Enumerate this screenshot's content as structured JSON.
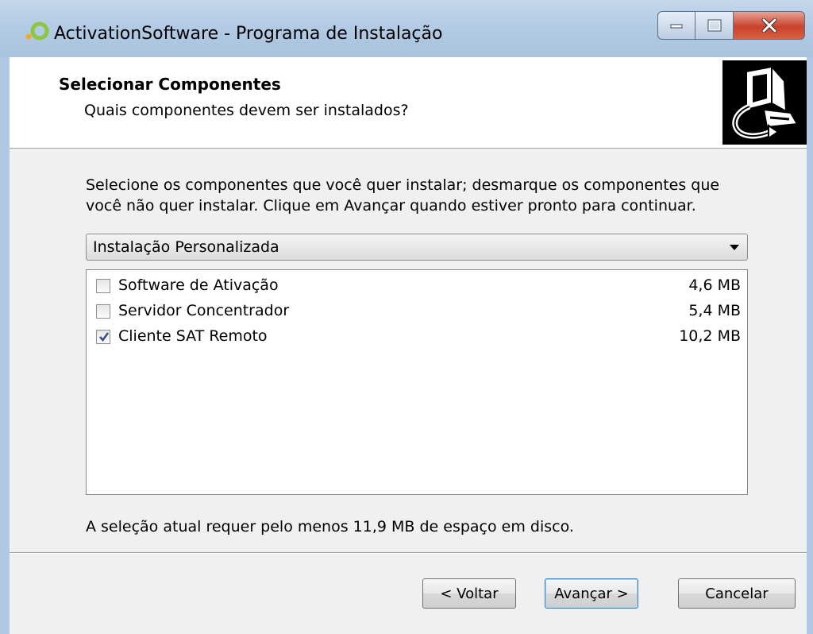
{
  "window": {
    "title": "ActivationSoftware - Programa de Instalação"
  },
  "header": {
    "title": "Selecionar Componentes",
    "subtitle": "Quais componentes devem ser instalados?"
  },
  "description": "Selecione os componentes que você quer instalar; desmarque os componentes que você não quer instalar. Clique em Avançar quando estiver pronto para continuar.",
  "install_type": {
    "selected": "Instalação Personalizada"
  },
  "components": [
    {
      "label": "Software de Ativação",
      "size": "4,6 MB",
      "checked": false
    },
    {
      "label": "Servidor Concentrador",
      "size": "5,4 MB",
      "checked": false
    },
    {
      "label": "Cliente SAT Remoto",
      "size": "10,2 MB",
      "checked": true
    }
  ],
  "requirement": "A seleção atual requer pelo menos 11,9 MB de espaço em disco.",
  "buttons": {
    "back": "< Voltar",
    "next": "Avançar >",
    "cancel": "Cancelar"
  },
  "colors": {
    "title_bar": "#b3cbe4",
    "close_button": "#c7422d",
    "logo_accent": "#8cc63f",
    "checkmark": "#3c4f8c"
  }
}
